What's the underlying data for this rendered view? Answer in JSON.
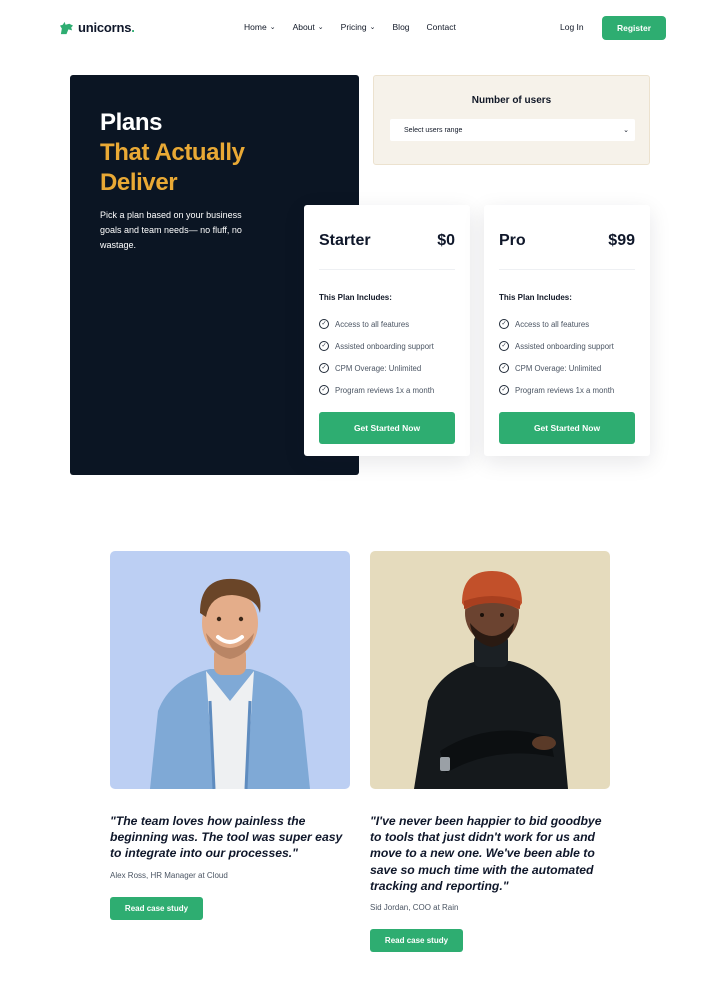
{
  "colors": {
    "brand": "#2ead71",
    "dark_panel": "#0b1523",
    "accent": "#e9a935",
    "users_box": "#f6f2ea"
  },
  "header": {
    "logo_text": "unicorns",
    "nav": [
      {
        "label": "Home",
        "dropdown": true
      },
      {
        "label": "About",
        "dropdown": true
      },
      {
        "label": "Pricing",
        "dropdown": true
      },
      {
        "label": "Blog",
        "dropdown": false
      },
      {
        "label": "Contact",
        "dropdown": false
      }
    ],
    "login_label": "Log In",
    "register_label": "Register"
  },
  "hero": {
    "title_line1": "Plans",
    "title_line2": "That Actually",
    "title_line3": "Deliver",
    "subtitle": "Pick a plan based on your business goals and team needs— no fluff, no wastage."
  },
  "users": {
    "title": "Number of users",
    "select_value": "Select users range"
  },
  "plans": [
    {
      "name": "Starter",
      "price": "$0",
      "includes_label": "This Plan Includes:",
      "features": [
        "Access to all features",
        "Assisted onboarding support",
        "CPM Overage: Unlimited",
        "Program reviews 1x a month"
      ],
      "cta": "Get Started Now"
    },
    {
      "name": "Pro",
      "price": "$99",
      "includes_label": "This Plan Includes:",
      "features": [
        "Access to all features",
        "Assisted onboarding support",
        "CPM Overage: Unlimited",
        "Program reviews 1x a month"
      ],
      "cta": "Get Started Now"
    }
  ],
  "testimonials": [
    {
      "quote": "\"The team loves how painless the beginning was. The tool was super easy to integrate into our processes.\"",
      "author": "Alex Ross, HR Manager at Cloud",
      "cta": "Read case study"
    },
    {
      "quote": "\"I've never been happier to bid goodbye to tools that just didn't work for us and move to a new one. We've been able to save so much time with the automated tracking and reporting.\"",
      "author": "Sid Jordan, COO at Rain",
      "cta": "Read case study"
    }
  ]
}
